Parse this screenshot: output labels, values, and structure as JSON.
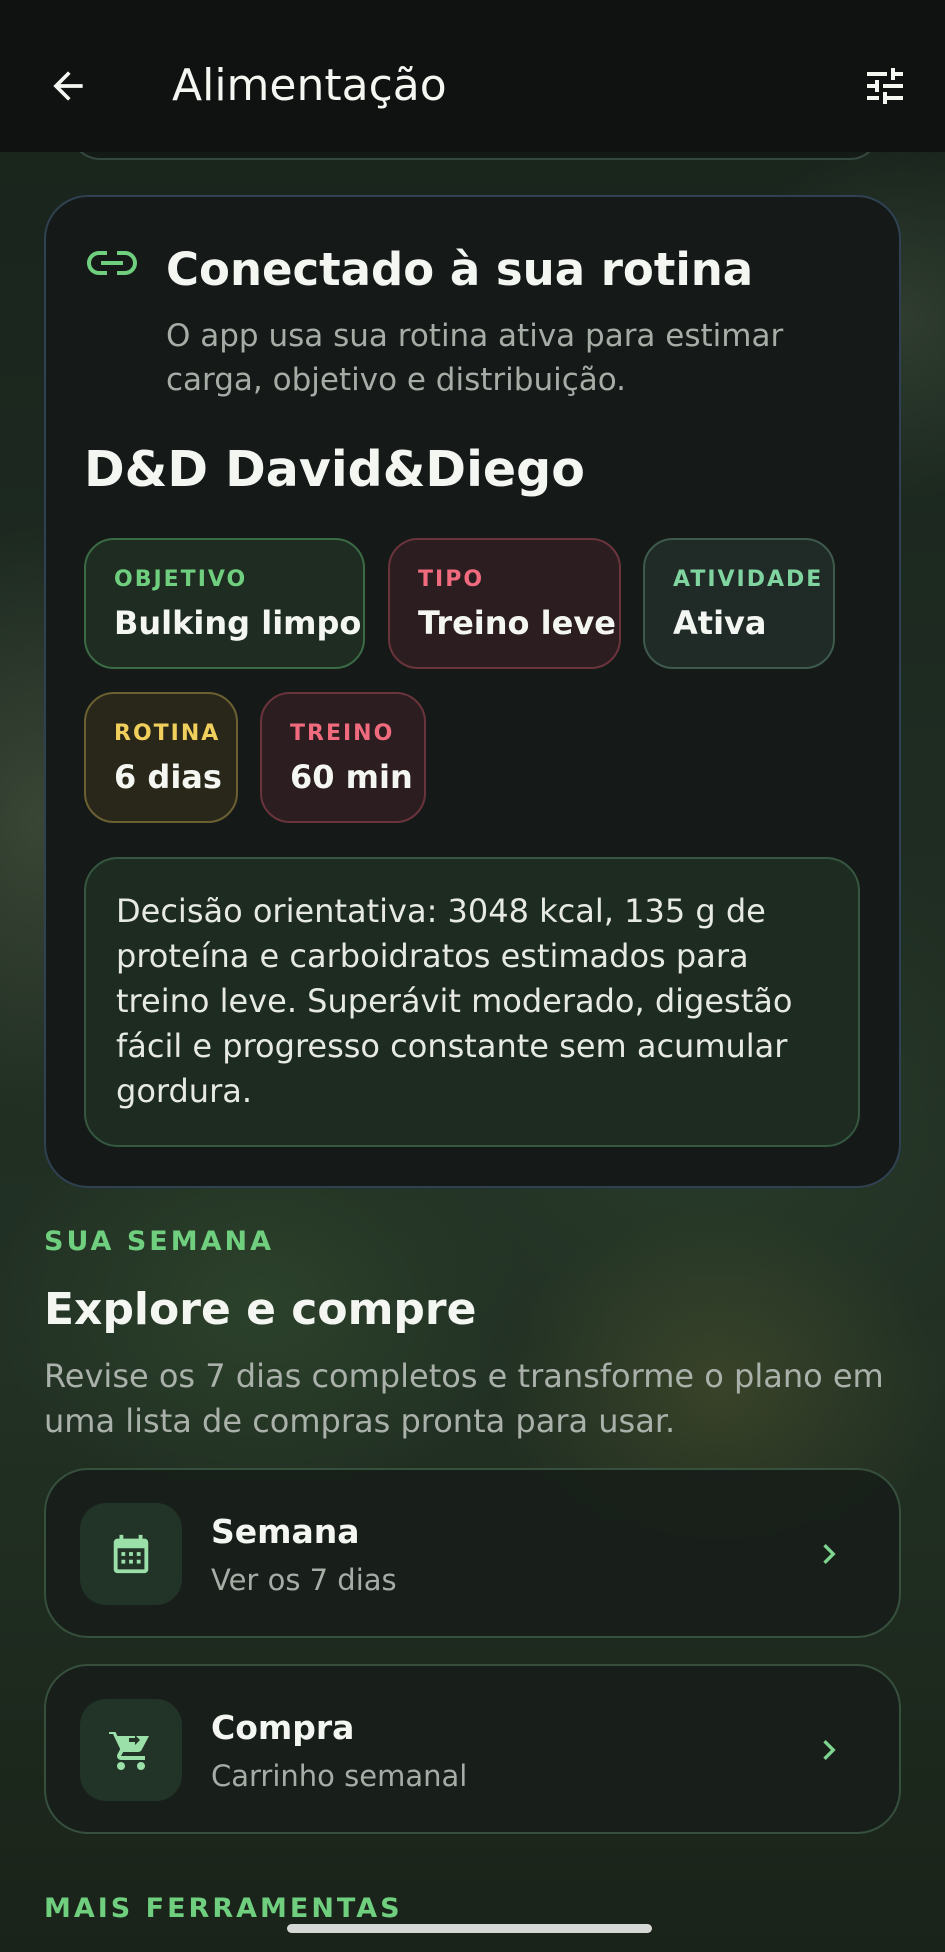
{
  "appbar": {
    "title": "Alimentação",
    "back_icon": "arrow-left-icon",
    "filter_icon": "tune-sliders-icon"
  },
  "routine_card": {
    "icon": "link-icon",
    "title": "Conectado à sua rotina",
    "description": "O app usa sua rotina ativa para estimar carga, objetivo e distribuição.",
    "routine_name": "D&D David&Diego",
    "chips": [
      {
        "label": "OBJETIVO",
        "value": "Bulking limpo",
        "color": "#6fcf7f"
      },
      {
        "label": "TIPO",
        "value": "Treino leve",
        "color": "#ef6b7d"
      },
      {
        "label": "ATIVIDADE",
        "value": "Ativa",
        "color": "#7fd4a0"
      },
      {
        "label": "ROTINA",
        "value": "6 dias",
        "color": "#f1cf5d"
      },
      {
        "label": "TREINO",
        "value": "60 min",
        "color": "#ef6b7d"
      }
    ],
    "decision": "Decisão orientativa: 3048 kcal, 135 g de proteína e carboidratos estimados para treino leve. Superávit moderado, digestão fácil e progresso constante sem acumular gordura."
  },
  "week_section": {
    "eyebrow": "SUA SEMANA",
    "title": "Explore e compre",
    "description": "Revise os 7 dias completos e transforme o plano em uma lista de compras pronta para usar.",
    "items": [
      {
        "title": "Semana",
        "subtitle": "Ver os 7 dias",
        "icon": "calendar-icon"
      },
      {
        "title": "Compra",
        "subtitle": "Carrinho semanal",
        "icon": "cart-icon"
      }
    ]
  },
  "more_section": {
    "eyebrow": "MAIS FERRAMENTAS"
  },
  "colors": {
    "accent_green": "#6fcf7f",
    "background": "#111612",
    "card": "#151a18"
  }
}
